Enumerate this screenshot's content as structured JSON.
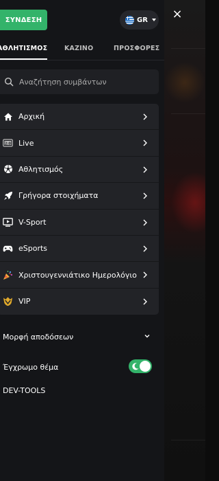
{
  "header": {
    "login_label": "ΣΥΝΔΕΣΗ",
    "language_code": "GR"
  },
  "close_icon": "×",
  "tabs": [
    {
      "label": "ΑΘΛΗΤΙΣΜΟΣ",
      "active": true
    },
    {
      "label": "ΚΑΖΙΝΟ",
      "active": false
    },
    {
      "label": "ΠΡΟΣΦΟΡΕΣ",
      "active": false
    }
  ],
  "search": {
    "placeholder": "Αναζήτηση συμβάντων"
  },
  "menu": {
    "items": [
      {
        "label": "Αρχική",
        "icon": "home-icon"
      },
      {
        "label": "Live",
        "icon": "live-tv-icon"
      },
      {
        "label": "Αθλητισμός",
        "icon": "soccer-ball-icon"
      },
      {
        "label": "Γρήγορα στοιχήματα",
        "icon": "rocket-icon"
      },
      {
        "label": "V-Sport",
        "icon": "monitor-play-icon"
      },
      {
        "label": "eSports",
        "icon": "gamepad-icon"
      },
      {
        "label": "Χριστουγεννιάτικο Ημερολόγιο",
        "icon": "party-popper-icon"
      },
      {
        "label": "VIP",
        "icon": "vip-crown-icon"
      }
    ]
  },
  "settings": {
    "odds_format_label": "Μορφή αποδόσεων",
    "color_theme_label": "Έγχρωμο θέμα",
    "color_theme_enabled": true,
    "devtools_label": "DEV-TOOLS"
  },
  "colors": {
    "accent": "#33b36a",
    "drawer_bg": "#141518",
    "item_bg": "#222327"
  }
}
